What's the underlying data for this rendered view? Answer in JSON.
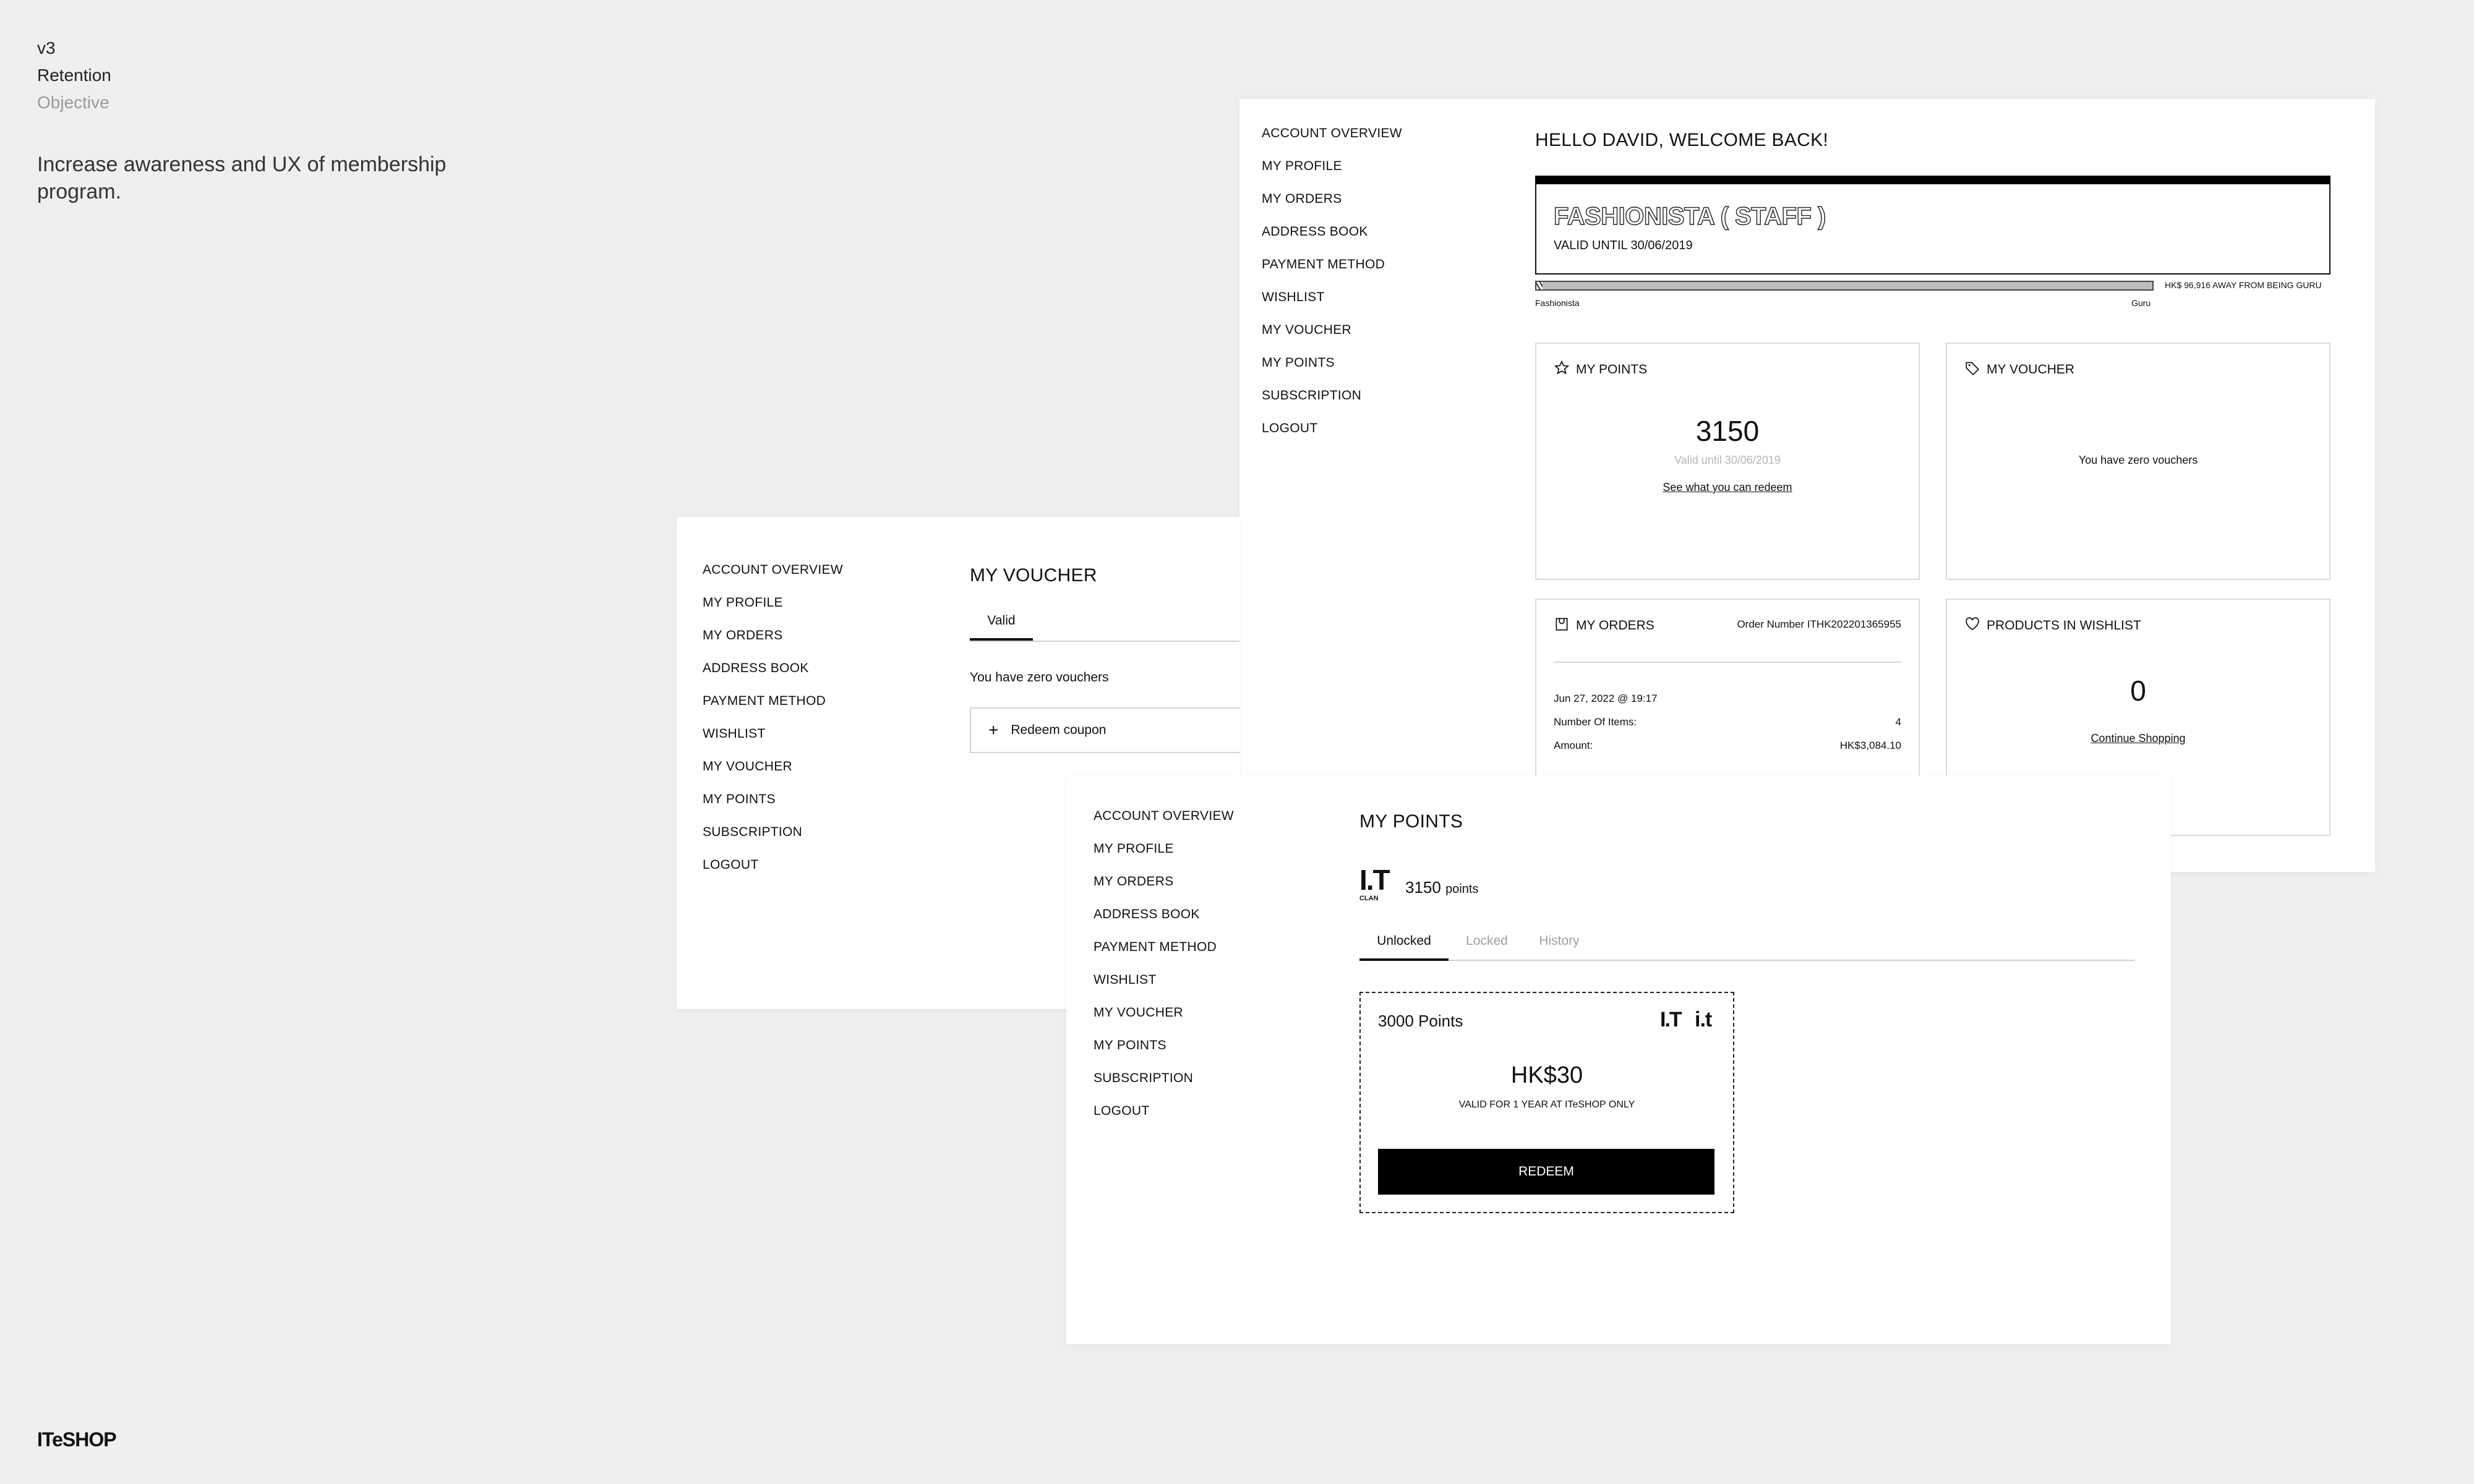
{
  "meta": {
    "version": "v3",
    "category": "Retention",
    "section": "Objective",
    "objective": "Increase awareness and UX of membership program.",
    "brand": "ITeSHOP"
  },
  "nav": [
    "ACCOUNT OVERVIEW",
    "MY PROFILE",
    "MY ORDERS",
    "ADDRESS BOOK",
    "PAYMENT METHOD",
    "WISHLIST",
    "MY VOUCHER",
    "MY POINTS",
    "SUBSCRIPTION",
    "LOGOUT"
  ],
  "overview": {
    "greeting": "HELLO DAVID, WELCOME BACK!",
    "tier_name": "FASHIONISTA ( STAFF )",
    "tier_valid": "VALID UNTIL 30/06/2019",
    "progress_fraction": 0.01,
    "progress_note": "HK$ 96,916 AWAY FROM BEING GURU",
    "tier_from": "Fashionista",
    "tier_to": "Guru",
    "points_label": "MY POINTS",
    "points_value": "3150",
    "points_valid": "Valid until 30/06/2019",
    "points_link": "See what you can redeem",
    "voucher_label": "MY VOUCHER",
    "voucher_empty": "You have zero vouchers",
    "orders_label": "MY ORDERS",
    "order_number": "Order Number ITHK202201365955",
    "order_date": "Jun 27, 2022 @ 19:17",
    "items_label": "Number Of Items:",
    "items_value": "4",
    "amount_label": "Amount:",
    "amount_value": "HK$3,084.10",
    "wishlist_label": "PRODUCTS IN WISHLIST",
    "wishlist_count": "0",
    "wishlist_link": "Continue Shopping"
  },
  "voucher_page": {
    "title": "MY VOUCHER",
    "tab_valid": "Valid",
    "empty": "You have zero vouchers",
    "redeem_label": "Redeem coupon"
  },
  "points_page": {
    "title": "MY POINTS",
    "logo_text": "I.T",
    "logo_sub": "CLAN",
    "points_value": "3150",
    "points_unit": "points",
    "tabs": [
      "Unlocked",
      "Locked",
      "History"
    ],
    "reward_points": "3000 Points",
    "reward_logo_1": "I.T",
    "reward_logo_2": "i.t",
    "reward_value": "HK$30",
    "reward_terms": "VALID FOR 1 YEAR AT ITeSHOP ONLY",
    "redeem_button": "REDEEM"
  }
}
